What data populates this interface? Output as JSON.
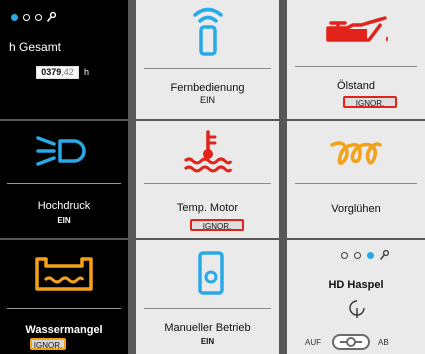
{
  "colors": {
    "accent_blue": "#28a9e8",
    "warning_red": "#e2231a",
    "warning_orange": "#f4a11a"
  },
  "pager_top_left": {
    "dots": [
      "active",
      "inactive",
      "inactive"
    ],
    "icon": "wrench-icon"
  },
  "hours": {
    "title": "h Gesamt",
    "value_main": "0379",
    "value_decimal": ",42",
    "unit": "h"
  },
  "tiles": {
    "remote": {
      "label": "Fernbedienung",
      "status": "EIN",
      "icon": "remote-control-icon"
    },
    "oil": {
      "label": "Ölstand",
      "button": "IGNOR.",
      "icon": "oil-can-icon"
    },
    "high_pressure": {
      "label": "Hochdruck",
      "status": "EIN",
      "icon": "high-pressure-lamp-icon"
    },
    "engine_temp": {
      "label": "Temp. Motor",
      "button": "IGNOR.",
      "icon": "coolant-temperature-icon"
    },
    "glow": {
      "label": "Vorglühen",
      "icon": "glow-plug-icon"
    },
    "water": {
      "label": "Wassermangel",
      "button": "IGNOR.",
      "icon": "water-tank-icon"
    },
    "manual": {
      "label": "Manueller Betrieb",
      "status": "EIN",
      "icon": "phone-mode-icon"
    }
  },
  "reel": {
    "dots": [
      "inactive",
      "inactive",
      "active"
    ],
    "icon": "wrench-icon",
    "title": "HD Haspel",
    "reel_icon": "hose-reel-icon",
    "toggle_left": "AUF",
    "toggle_right": "AB"
  }
}
